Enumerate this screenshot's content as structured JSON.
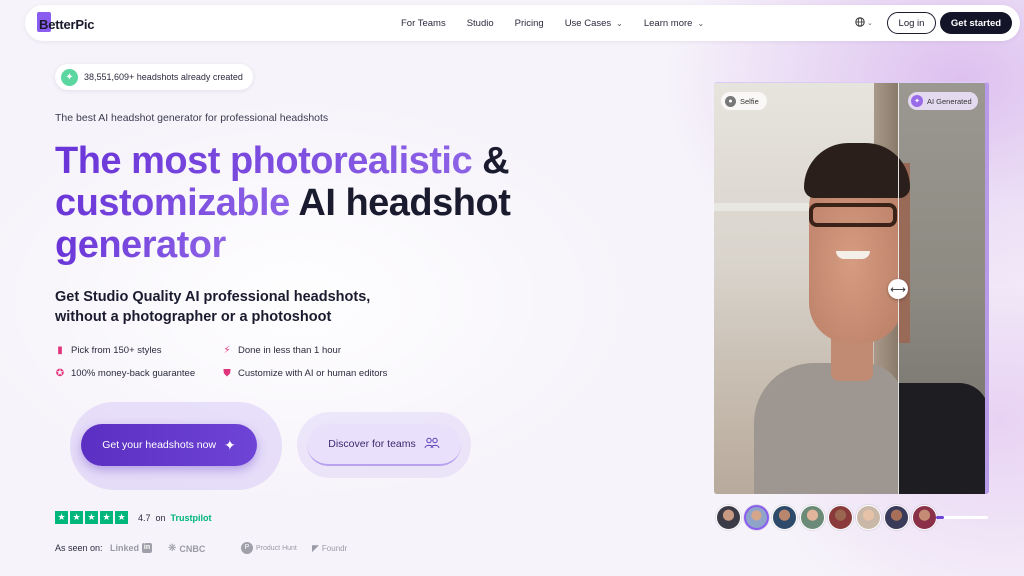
{
  "nav": {
    "logo": "BetterPic",
    "links": [
      {
        "label": "For Teams",
        "dropdown": false
      },
      {
        "label": "Studio",
        "dropdown": false
      },
      {
        "label": "Pricing",
        "dropdown": false
      },
      {
        "label": "Use Cases",
        "dropdown": true
      },
      {
        "label": "Learn more",
        "dropdown": true
      }
    ],
    "login": "Log in",
    "get_started": "Get started"
  },
  "hero": {
    "counter": "38,551,609+ headshots already created",
    "tagline": "The best AI headshot generator for professional headshots",
    "headline_purple_1": "The most photorealistic",
    "headline_dark_1": " &",
    "headline_purple_2": "customizable",
    "headline_dark_2": " AI headshot",
    "headline_purple_3": "generator",
    "subhead": "Get Studio Quality AI professional headshots, without a photographer or a photoshoot",
    "features": [
      "Pick from 150+ styles",
      "Done in less than 1 hour",
      "100% money-back guarantee",
      "Customize with AI or human editors"
    ],
    "cta_primary": "Get your headshots now",
    "cta_secondary": "Discover for teams",
    "rating": "4.7",
    "rating_on": "on",
    "rating_brand": "Trustpilot",
    "seen_on": "As seen on:",
    "press": [
      "Linked",
      "in",
      "CNBC",
      "Product Hunt",
      "Foundr"
    ]
  },
  "compare": {
    "selfie_label": "Selfie",
    "ai_label": "AI Generated",
    "slider_position": 0.67,
    "thumb_count": 8,
    "active_thumb": 1,
    "progress": 0.15
  },
  "colors": {
    "accent": "#6e44d6",
    "trustpilot": "#00b67a",
    "dark": "#141428"
  },
  "icons": {
    "counter": "sparkle-icon",
    "globe": "globe-icon",
    "style": "palette-icon",
    "time": "bolt-icon",
    "guarantee": "badge-icon",
    "edit": "shield-icon"
  }
}
